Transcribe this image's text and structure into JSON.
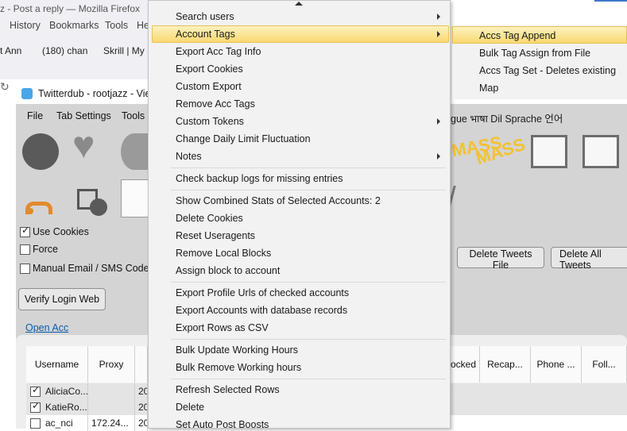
{
  "firefox": {
    "title": "z - Post a reply — Mozilla Firefox",
    "menu": [
      "History",
      "Bookmarks",
      "Tools",
      "He"
    ],
    "bookmarks": [
      "t Ann",
      "(180) chan",
      "Skrill | My"
    ]
  },
  "app": {
    "title": "Twitterdub - rootjazz - Vie",
    "menu": [
      "File",
      "Tab Settings",
      "Tools"
    ],
    "lang_text": "gue भाषा Dil Sprache 언어",
    "mass_label": "MASS",
    "options": {
      "use_cookies": {
        "label": "Use Cookies",
        "checked": true
      },
      "force": {
        "label": "Force",
        "checked": false
      },
      "manual_email": {
        "label": "Manual Email / SMS  Code",
        "checked": false
      }
    },
    "verify_button": "Verify Login Web",
    "open_acc_link": "Open Acc",
    "delete_tweets_file": "Delete Tweets File",
    "delete_all_tweets": "Delete All Tweets",
    "grid": {
      "headers": [
        "Username",
        "Proxy",
        "ocked",
        "Recap...",
        "Phone ...",
        "Foll..."
      ],
      "rows": [
        {
          "checked": true,
          "username": "AliciaCo...",
          "proxy": "",
          "date": "20"
        },
        {
          "checked": true,
          "username": "KatieRo...",
          "proxy": "",
          "date": "20"
        },
        {
          "checked": false,
          "username": "ac_nci",
          "proxy": "172.24...",
          "date": "20"
        }
      ]
    }
  },
  "context_menu": {
    "items": [
      "Search users",
      "Account Tags",
      "Export Acc Tag Info",
      "Export Cookies",
      "Custom Export",
      "Remove Acc Tags",
      "Custom Tokens",
      "Change Daily Limit Fluctuation",
      "Notes",
      "Check backup logs for missing entries",
      "Show Combined Stats of Selected Accounts: 2",
      "Delete Cookies",
      "Reset Useragents",
      "Remove Local Blocks",
      "Assign block to account",
      "Export Profile Urls of checked accounts",
      "Export Accounts with database records",
      "Export Rows as CSV",
      "Bulk Update Working Hours",
      "Bulk Remove Working hours",
      "Refresh Selected Rows",
      "Delete",
      "Set Auto Post Boosts"
    ],
    "highlighted": "Account Tags"
  },
  "submenu": {
    "items": [
      "Accs Tag Append",
      "Bulk Tag Assign from File",
      "Accs Tag Set - Deletes existing",
      "Map"
    ],
    "highlighted": "Accs Tag Append"
  },
  "colors": {
    "highlight": "#f8d970",
    "window_bg": "#d4d4d4",
    "link": "#0b5cad"
  }
}
